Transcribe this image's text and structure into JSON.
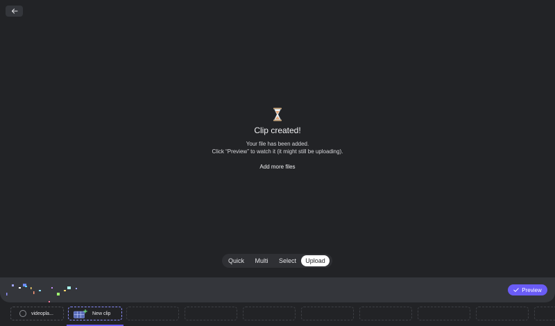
{
  "nav": {
    "back_icon": "arrow-left-icon"
  },
  "status": {
    "icon": "hourglass-icon",
    "title": "Clip created!",
    "line1": "Your file has been added.",
    "line2": "Click “Preview” to watch it (it might still be uploading).",
    "add_more": "Add more files"
  },
  "modes": {
    "items": [
      "Quick",
      "Multi",
      "Select",
      "Upload"
    ],
    "active": "Upload"
  },
  "tray": {
    "preview_label": "Preview",
    "preview_icon": "check-icon",
    "accent": "#6a5cf6"
  },
  "clips": {
    "items": [
      {
        "label": "videopla...",
        "icon": "radio-icon"
      },
      {
        "label": "New clip",
        "icon": "film-add-icon"
      }
    ]
  }
}
